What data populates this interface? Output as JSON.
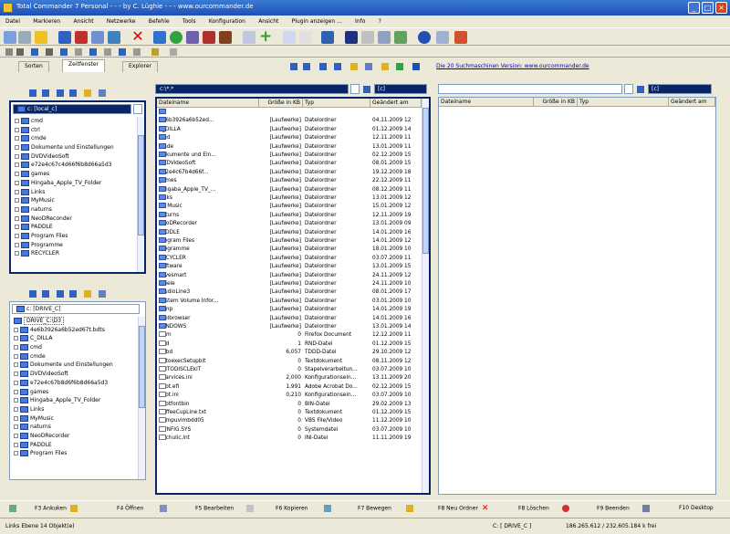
{
  "window": {
    "title": "Total Commander 7 Personal - - - by C. Lüghie - - - www.ourcommander.de",
    "buttons": [
      "_",
      "□",
      "×"
    ]
  },
  "menu": [
    "Datei",
    "Markieren",
    "Ansicht",
    "Netzwerke",
    "Befehle",
    "Tools",
    "Konfiguration",
    "Ansicht",
    "Plugin anzeigen ...",
    "Info",
    "?"
  ],
  "tabs": {
    "items": [
      "Sorten",
      "Zeitfenster",
      "Explorer"
    ],
    "active": 1
  },
  "link_text": "Die 20 Suchmaschinen Version: www.ourcommander.de",
  "left_tree_top": {
    "drive": "c: [local_c]",
    "items": [
      "cmd",
      "ctrl",
      "cmde",
      "Dokumente und Einstellungen",
      "DVDVideoSoft",
      "e72e4c67c4d66f6b8d66a5d3",
      "games",
      "Hingaba_Apple_TV_Folder",
      "Links",
      "MyMusic",
      "naturns",
      "NeoDReconder",
      "PADDLE",
      "Program Files",
      "Programme",
      "RECYCLER"
    ]
  },
  "left_tree_bottom": {
    "drive": "c: [DRIVE_C]",
    "selected": "DRIVE_C:\\D3",
    "items": [
      "4e6b3926a6b52ed67t.bdts",
      "C_DILLA",
      "cmd",
      "cmde",
      "Dokumente und Einstellungen",
      "DVDVideoSoft",
      "e72e4c67b8d6f6b8d66a5d3",
      "games",
      "Hingaba_Apple_TV_Folder",
      "Links",
      "MyMusic",
      "naturns",
      "NeoDRecorder",
      "PADDLE",
      "Program Files"
    ]
  },
  "middle_pane": {
    "path": "c:\\*.*",
    "drive": "[c]",
    "columns": [
      "Dateiname",
      "Größe in KB",
      "Typ",
      "Geändert am"
    ],
    "rows": [
      [
        "..",
        "",
        "",
        ""
      ],
      [
        "4e6b3926a6b52ed...",
        "[Laufwerke]",
        "Dateiordner",
        "04.11.2009 12"
      ],
      [
        "C_DILLA",
        "[Laufwerke]",
        "Dateiordner",
        "01.12.2009 14"
      ],
      [
        "cmd",
        "[Laufwerke]",
        "Dateiordner",
        "12.11.2009 11"
      ],
      [
        "cmde",
        "[Laufwerke]",
        "Dateiordner",
        "13.01.2009 11"
      ],
      [
        "Dokumente und Ein...",
        "[Laufwerke]",
        "Dateiordner",
        "02.12.2009 15"
      ],
      [
        "DVDVideoSoft",
        "[Laufwerke]",
        "Dateiordner",
        "08.01.2009 15"
      ],
      [
        "e72e4c67b4d66f...",
        "[Laufwerke]",
        "Dateiordner",
        "19.12.2009 18"
      ],
      [
        "games",
        "[Laufwerke]",
        "Dateiordner",
        "22.12.2009 11"
      ],
      [
        "Hingaba_Apple_TV_...",
        "[Laufwerke]",
        "Dateiordner",
        "08.12.2009 11"
      ],
      [
        "Links",
        "[Laufwerke]",
        "Dateiordner",
        "13.01.2009 12"
      ],
      [
        "Mr Music",
        "[Laufwerke]",
        "Dateiordner",
        "15.01.2009 12"
      ],
      [
        "naturns",
        "[Laufwerke]",
        "Dateiordner",
        "12.11.2009 19"
      ],
      [
        "NeoDRecorder",
        "[Laufwerke]",
        "Dateiordner",
        "13.01.2009 09"
      ],
      [
        "PADDLE",
        "[Laufwerke]",
        "Dateiordner",
        "14.01.2009 16"
      ],
      [
        "Program Files",
        "[Laufwerke]",
        "Dateiordner",
        "14.01.2009 12"
      ],
      [
        "Programme",
        "[Laufwerke]",
        "Dateiordner",
        "18.01.2009 10"
      ],
      [
        "RECYCLER",
        "[Laufwerke]",
        "Dateiordner",
        "03.07.2009 11"
      ],
      [
        "Software",
        "[Laufwerke]",
        "Dateiordner",
        "13.01.2009 15"
      ],
      [
        "savesmart",
        "[Laufwerke]",
        "Dateiordner",
        "24.11.2009 12"
      ],
      [
        "Spiele",
        "[Laufwerke]",
        "Dateiordner",
        "24.11.2009 10"
      ],
      [
        "StudioLine3",
        "[Laufwerke]",
        "Dateiordner",
        "08.01.2009 17"
      ],
      [
        "System Volume Infor...",
        "[Laufwerke]",
        "Dateiordner",
        "03.01.2009 10"
      ],
      [
        "temp",
        "[Laufwerke]",
        "Dateiordner",
        "14.01.2009 19"
      ],
      [
        "Toolbrowser",
        "[Laufwerke]",
        "Dateiordner",
        "14.01.2009 16"
      ],
      [
        "WINDOWS",
        "[Laufwerke]",
        "Dateiordner",
        "13.01.2009 14"
      ],
      [
        ".ittm",
        "0",
        "Firefox Document",
        "12.12.2009 11"
      ],
      [
        ".rnd",
        "1",
        "RND-Datei",
        "01.12.2009 15"
      ],
      [
        ".tbbd",
        "6,057",
        "TDDD-Datei",
        "29.10.2009 12"
      ],
      [
        "AutoexecSetupbit",
        "0",
        "Textdokument",
        "08.11.2009 12"
      ],
      [
        "aulTODISCLEkiT",
        "0",
        "Stapelverarbeitun...",
        "03.07.2009 10"
      ],
      [
        "bearvices.ini",
        "2,000",
        "Konfigurationsein...",
        "13.11.2009 20"
      ],
      [
        "boot.efi",
        "1,991",
        "Adobe Acrobat Do...",
        "02.12.2009 15"
      ],
      [
        "boot.ini",
        "0,210",
        "Konfigurationsein...",
        "03.07.2009 10"
      ],
      [
        "bootfontbin",
        "0",
        "BIN-Datei",
        "29.02.2009 13"
      ],
      [
        "CoffeeCupLine.txt",
        "0",
        "Textdokument",
        "01.12.2009 15"
      ],
      [
        "Compuvimbdd05",
        "0",
        "VBS File/Video",
        "11.12.2009 10"
      ],
      [
        "CONFIG.SYS",
        "0",
        "Systemdatei",
        "03.07.2009 10"
      ],
      [
        "Cachulic.int",
        "0",
        "INI-Datei",
        "11.11.2009 19"
      ]
    ]
  },
  "right_pane": {
    "drive": "[c]",
    "columns": [
      "Dateiname",
      "Größe in KB",
      "Typ",
      "Geändert am"
    ]
  },
  "fkeys": [
    "F3 Ankuken",
    "F4 Öffnen",
    "F5 Bearbeiten",
    "F6 Kopieren",
    "F7 Bewegen",
    "F8 Neu Ordner",
    "F8 Löschen",
    "F9 Beenden",
    "F10 Desktop"
  ],
  "status": {
    "left": "Links Ebene 14 Objekt(e)",
    "middle": "C: [ DRIVE_C ]",
    "right": "186.265.612 / 232.605.184 k frei"
  },
  "colors": {
    "titlebar": "#1d4fb8",
    "selection": "#316ac5",
    "link": "#0000c0"
  }
}
